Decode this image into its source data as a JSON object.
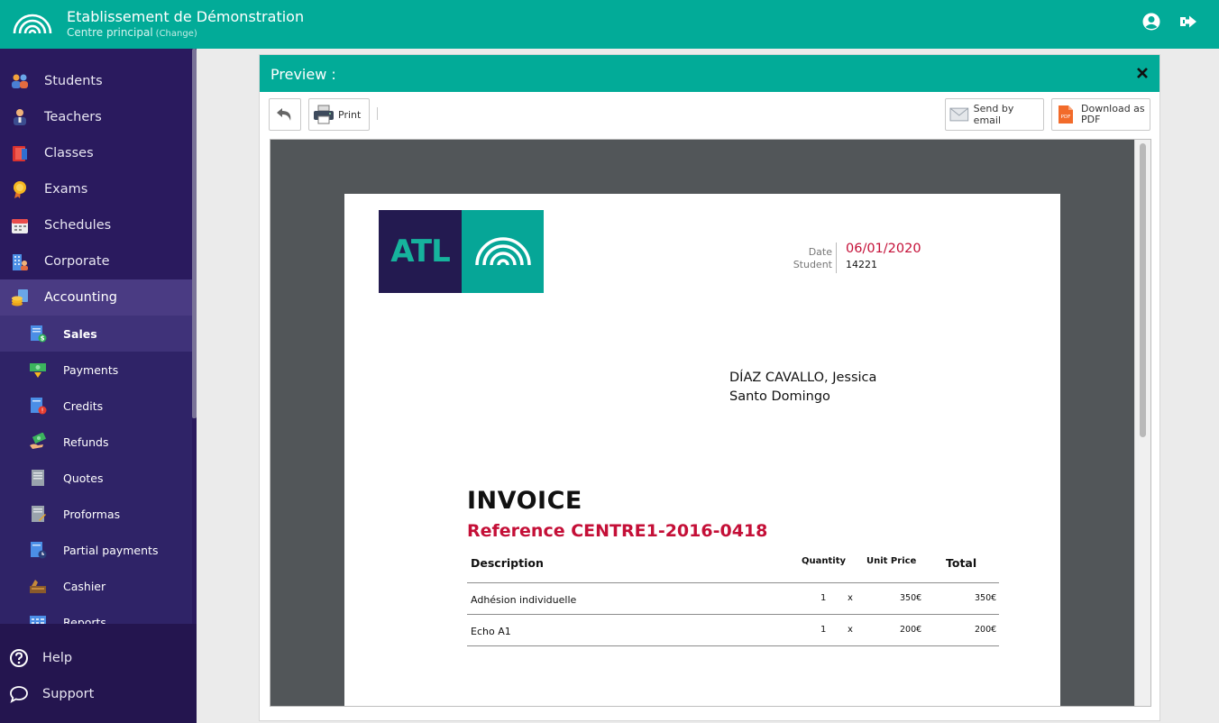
{
  "topbar": {
    "org_name": "Etablissement de Démonstration",
    "centre_name": "Centre principal",
    "change_label": "(Change)"
  },
  "sidebar": {
    "items": [
      {
        "label": "Students",
        "icon": "students-icon"
      },
      {
        "label": "Teachers",
        "icon": "teacher-icon"
      },
      {
        "label": "Classes",
        "icon": "books-icon"
      },
      {
        "label": "Exams",
        "icon": "medal-icon"
      },
      {
        "label": "Schedules",
        "icon": "calendar-icon"
      },
      {
        "label": "Corporate",
        "icon": "building-icon"
      },
      {
        "label": "Accounting",
        "icon": "coins-icon",
        "active": true
      }
    ],
    "subitems": [
      {
        "label": "Sales",
        "icon": "sales-icon",
        "active": true
      },
      {
        "label": "Payments",
        "icon": "payment-icon"
      },
      {
        "label": "Credits",
        "icon": "credit-icon"
      },
      {
        "label": "Refunds",
        "icon": "refund-icon"
      },
      {
        "label": "Quotes",
        "icon": "quote-icon"
      },
      {
        "label": "Proformas",
        "icon": "proforma-icon"
      },
      {
        "label": "Partial payments",
        "icon": "partial-payment-icon"
      },
      {
        "label": "Cashier",
        "icon": "cashier-icon"
      },
      {
        "label": "Reports",
        "icon": "report-icon"
      }
    ],
    "bottom": [
      {
        "label": "Help",
        "icon": "help-icon"
      },
      {
        "label": "Support",
        "icon": "chat-icon"
      }
    ]
  },
  "dialog": {
    "title": "Preview :",
    "print_label": "Print",
    "email_label": "Send by email",
    "pdf_label_1": "Download as",
    "pdf_label_2": "PDF",
    "pdf_badge": "PDF"
  },
  "invoice": {
    "logo_text": "ATL",
    "date_label": "Date",
    "date_value": "06/01/2020",
    "student_label": "Student",
    "student_value": "14221",
    "address_line1": "DÍAZ CAVALLO, Jessica",
    "address_line2": "Santo Domingo",
    "title": "INVOICE",
    "reference": "Reference CENTRE1-2016-0418",
    "headers": {
      "description": "Description",
      "quantity": "Quantity",
      "unit_price": "Unit Price",
      "total": "Total"
    },
    "rows": [
      {
        "description": "Adhésion individuelle",
        "quantity": "1",
        "x": "x",
        "unit_price": "350€",
        "total": "350€"
      },
      {
        "description": "Echo A1",
        "quantity": "1",
        "x": "x",
        "unit_price": "200€",
        "total": "200€"
      }
    ]
  },
  "colors": {
    "brand_teal": "#02ab98",
    "sidebar_bg": "#2a1a5e",
    "accent_red": "#c40f37"
  }
}
